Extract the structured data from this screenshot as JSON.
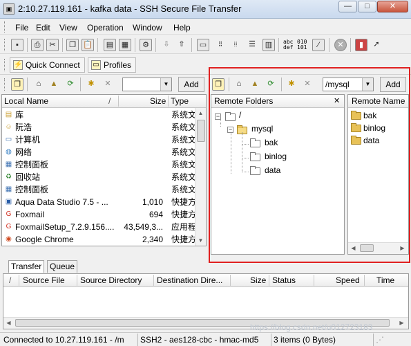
{
  "window": {
    "title": "2:10.27.119.161 - kafka data - SSH Secure File Transfer",
    "minimize_glyph": "—",
    "maximize_glyph": "□",
    "close_glyph": "✕"
  },
  "menu": [
    "File",
    "Edit",
    "View",
    "Operation",
    "Window",
    "Help"
  ],
  "toolbar_text": {
    "abc": "abc",
    "def": "def",
    "n010": "010",
    "n101": "101"
  },
  "quickbar": {
    "quick_connect": "Quick Connect",
    "profiles": "Profiles"
  },
  "local": {
    "path_value": "",
    "add_label": "Add",
    "columns": {
      "name": "Local Name",
      "sort": "/",
      "size": "Size",
      "type": "Type"
    },
    "rows": [
      {
        "name": "库",
        "size": "",
        "type": "系统文",
        "icon": "library-icon"
      },
      {
        "name": "阮浩",
        "size": "",
        "type": "系统文",
        "icon": "user-folder-icon"
      },
      {
        "name": "计算机",
        "size": "",
        "type": "系统文",
        "icon": "computer-icon"
      },
      {
        "name": "网络",
        "size": "",
        "type": "系统文",
        "icon": "network-icon"
      },
      {
        "name": "控制面板",
        "size": "",
        "type": "系统文",
        "icon": "control-panel-icon"
      },
      {
        "name": "回收站",
        "size": "",
        "type": "系统文",
        "icon": "recycle-bin-icon"
      },
      {
        "name": "控制面板",
        "size": "",
        "type": "系统文",
        "icon": "control-panel-icon"
      },
      {
        "name": "Aqua Data Studio 7.5 - ...",
        "size": "1,010",
        "type": "快捷方",
        "icon": "shortcut-icon"
      },
      {
        "name": "Foxmail",
        "size": "694",
        "type": "快捷方",
        "icon": "foxmail-icon"
      },
      {
        "name": "FoxmailSetup_7.2.9.156....",
        "size": "43,549,3...",
        "type": "应用程",
        "icon": "foxmail-icon"
      },
      {
        "name": "Google Chrome",
        "size": "2,340",
        "type": "快捷方",
        "icon": "chrome-icon"
      }
    ]
  },
  "remote": {
    "path_value": "/mysql",
    "add_label": "Add",
    "folders_header": "Remote Folders",
    "close_glyph": "✕",
    "tree": {
      "root": "/",
      "child": "mysql",
      "grandchildren": [
        "bak",
        "binlog",
        "data"
      ]
    },
    "name_header": "Remote Name",
    "items": [
      "bak",
      "binlog",
      "data"
    ]
  },
  "transfer": {
    "tabs": [
      "Transfer",
      "Queue"
    ],
    "columns": {
      "sort": "/",
      "source_file": "Source File",
      "source_directory": "Source Directory",
      "destination": "Destination Dire...",
      "size": "Size",
      "status": "Status",
      "speed": "Speed",
      "time": "Time"
    }
  },
  "status": {
    "connection": "Connected to 10.27.119.161 - /m",
    "cipher": "SSH2 - aes128-cbc - hmac-md5",
    "items": "3 items (0 Bytes)",
    "watermark": "https://blog.csdn.net/u012723183"
  },
  "colors": {
    "highlight_box": "#e02020",
    "folder": "#e8c258"
  }
}
